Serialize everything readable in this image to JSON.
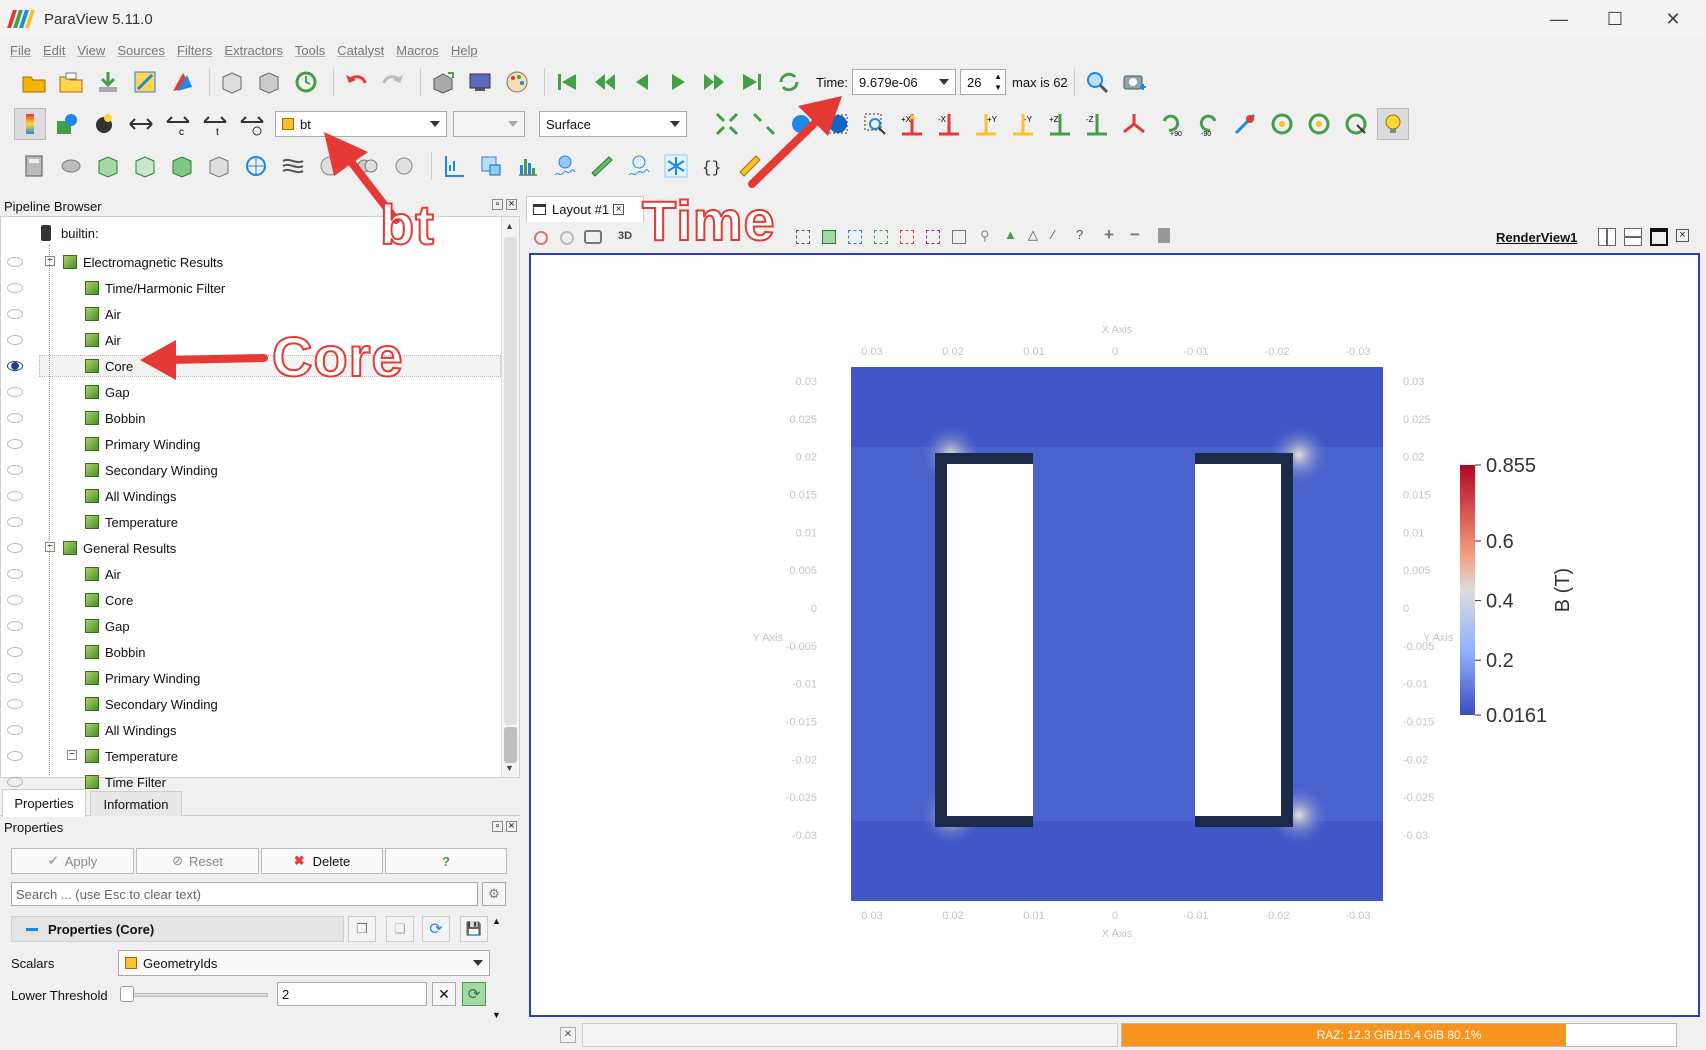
{
  "window": {
    "title": "ParaView 5.11.0",
    "minimize": "—",
    "maximize": "☐",
    "close": "✕"
  },
  "menu": [
    "File",
    "Edit",
    "View",
    "Sources",
    "Filters",
    "Extractors",
    "Tools",
    "Catalyst",
    "Macros",
    "Help"
  ],
  "time_toolbar": {
    "label": "Time:",
    "value": "9.679e-06",
    "step": "26",
    "max_label": "max is 62"
  },
  "active_variables": {
    "array": "bt",
    "component": "",
    "representation": "Surface"
  },
  "pipeline": {
    "title": "Pipeline Browser",
    "root": "builtin:",
    "items": [
      {
        "label": "Electromagnetic Results",
        "level": 1,
        "visible": false,
        "expander": "−"
      },
      {
        "label": "Time/Harmonic Filter",
        "level": 2,
        "visible": false
      },
      {
        "label": "Air",
        "level": 2,
        "visible": false
      },
      {
        "label": "Air",
        "level": 2,
        "visible": false
      },
      {
        "label": "Core",
        "level": 2,
        "visible": true,
        "selected": true
      },
      {
        "label": "Gap",
        "level": 2,
        "visible": false
      },
      {
        "label": "Bobbin",
        "level": 2,
        "visible": false
      },
      {
        "label": "Primary Winding",
        "level": 2,
        "visible": false
      },
      {
        "label": "Secondary Winding",
        "level": 2,
        "visible": false
      },
      {
        "label": "All Windings",
        "level": 2,
        "visible": false
      },
      {
        "label": "Temperature",
        "level": 2,
        "visible": false
      },
      {
        "label": "General Results",
        "level": 1,
        "visible": false,
        "expander": "−"
      },
      {
        "label": "Air",
        "level": 2,
        "visible": false
      },
      {
        "label": "Core",
        "level": 2,
        "visible": false
      },
      {
        "label": "Gap",
        "level": 2,
        "visible": false
      },
      {
        "label": "Bobbin",
        "level": 2,
        "visible": false
      },
      {
        "label": "Primary Winding",
        "level": 2,
        "visible": false
      },
      {
        "label": "Secondary Winding",
        "level": 2,
        "visible": false
      },
      {
        "label": "All Windings",
        "level": 2,
        "visible": false
      },
      {
        "label": "Temperature",
        "level": 2,
        "visible": false,
        "expander": "−"
      },
      {
        "label": "Time Filter",
        "level": 2,
        "visible": false
      }
    ]
  },
  "tabs": {
    "properties": "Properties",
    "information": "Information"
  },
  "properties": {
    "title": "Properties",
    "apply": "Apply",
    "reset": "Reset",
    "delete": "Delete",
    "help": "?",
    "search_placeholder": "Search ... (use Esc to clear text)",
    "section": "Properties (Core)",
    "scalars_label": "Scalars",
    "scalars_value": "GeometryIds",
    "lower_label": "Lower Threshold",
    "lower_value": "2"
  },
  "layout": {
    "tab": "Layout #1",
    "mode3d": "3D",
    "view_name": "RenderView1"
  },
  "render": {
    "x_axis_title": "X Axis",
    "y_axis_title": "Y Axis",
    "x_ticks": [
      "0.03",
      "0.02",
      "0.01",
      "0",
      "-0.01",
      "-0.02",
      "-0.03"
    ],
    "y_ticks": [
      "0.03",
      "0.025",
      "0.02",
      "0.015",
      "0.01",
      "0.005",
      "0",
      "-0.005",
      "-0.01",
      "-0.015",
      "-0.02",
      "-0.025",
      "-0.03"
    ],
    "colorbar": {
      "title": "B (T)",
      "labels": [
        "0.855",
        "0.6",
        "0.4",
        "0.2",
        "0.0161"
      ],
      "values": [
        0.855,
        0.6,
        0.4,
        0.2,
        0.0161
      ]
    }
  },
  "status": {
    "memory": "RAZ: 12.3 GiB/15.4 GiB 80.1%",
    "memory_fraction": 0.801
  },
  "annotations": {
    "bt": "bt",
    "time": "Time",
    "core": "Core"
  },
  "colors": {
    "accent_red": "#e53935",
    "memory_bar": "#f7941d",
    "selection": "#e8e8e8"
  }
}
